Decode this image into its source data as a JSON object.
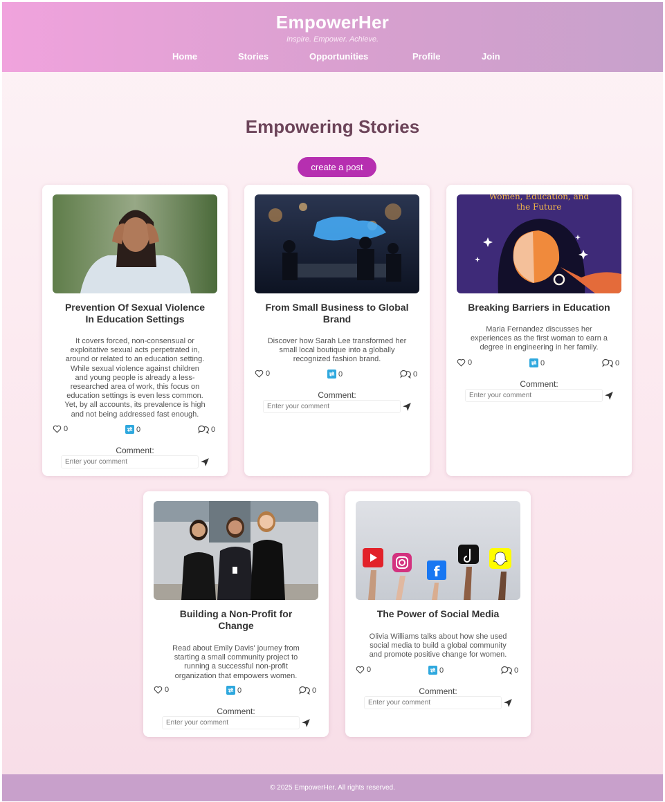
{
  "header": {
    "brand": "EmpowerHer",
    "tagline": "Inspire. Empower. Achieve.",
    "nav": [
      "Home",
      "Stories",
      "Opportunities",
      "Profile",
      "Join"
    ]
  },
  "main": {
    "title": "Empowering Stories",
    "create_label": "create a post"
  },
  "comment_label": "Comment:",
  "comment_placeholder": "Enter your comment",
  "cards": [
    {
      "title_lines": [
        "Prevention Of Sexual Violence",
        "In Education Settings"
      ],
      "desc_lines": [
        "It covers forced, non-consensual or",
        "exploitative sexual acts perpetrated in,",
        "around or related to an education setting.",
        "While sexual violence against children",
        "and young people is already a less-",
        "researched area of work, this focus on",
        "education settings is even less common.",
        "Yet, by all accounts, its prevalence is high",
        "and not being addressed fast enough."
      ],
      "likes": "0",
      "shares": "0",
      "comments": "0"
    },
    {
      "title_lines": [
        "From Small Business to Global",
        "Brand"
      ],
      "desc_lines": [
        "Discover how Sarah Lee transformed her",
        "small local boutique into a globally",
        "recognized fashion brand."
      ],
      "likes": "0",
      "shares": "0",
      "comments": "0"
    },
    {
      "title_lines": [
        "Breaking Barriers in Education"
      ],
      "image_text_lines": [
        "Women, Education, and",
        "the Future"
      ],
      "desc_lines": [
        "Maria Fernandez discusses her",
        "experiences as the first woman to earn a",
        "degree in engineering in her family."
      ],
      "likes": "0",
      "shares": "0",
      "comments": "0"
    },
    {
      "title_lines": [
        "Building a Non-Profit for",
        "Change"
      ],
      "desc_lines": [
        "Read about Emily Davis' journey from",
        "starting a small community project to",
        "running a successful non-profit",
        "organization that empowers women."
      ],
      "likes": "0",
      "shares": "0",
      "comments": "0"
    },
    {
      "title_lines": [
        "The Power of Social Media"
      ],
      "desc_lines": [
        "Olivia Williams talks about how she used",
        "social media to build a global community",
        "and promote positive change for women."
      ],
      "likes": "0",
      "shares": "0",
      "comments": "0"
    }
  ],
  "footer": {
    "text": "© 2025 EmpowerHer. All rights reserved."
  },
  "colors": {
    "accent": "#b62fb0",
    "heading": "#6c4459",
    "share_icon": "#2fa8de",
    "footer": "#c8a0cb"
  }
}
